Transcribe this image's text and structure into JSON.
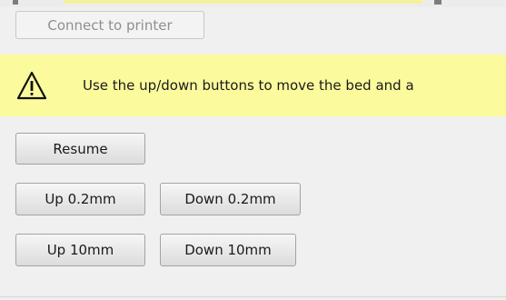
{
  "connect_button": {
    "label": "Connect to printer",
    "disabled": true
  },
  "warning_banner": {
    "icon": "warning-triangle-icon",
    "message": "Use the up/down buttons to move the bed and a",
    "background": "#fbfa9c"
  },
  "controls": {
    "resume_label": "Resume",
    "up_small_label": "Up 0.2mm",
    "down_small_label": "Down 0.2mm",
    "up_large_label": "Up 10mm",
    "down_large_label": "Down 10mm"
  }
}
